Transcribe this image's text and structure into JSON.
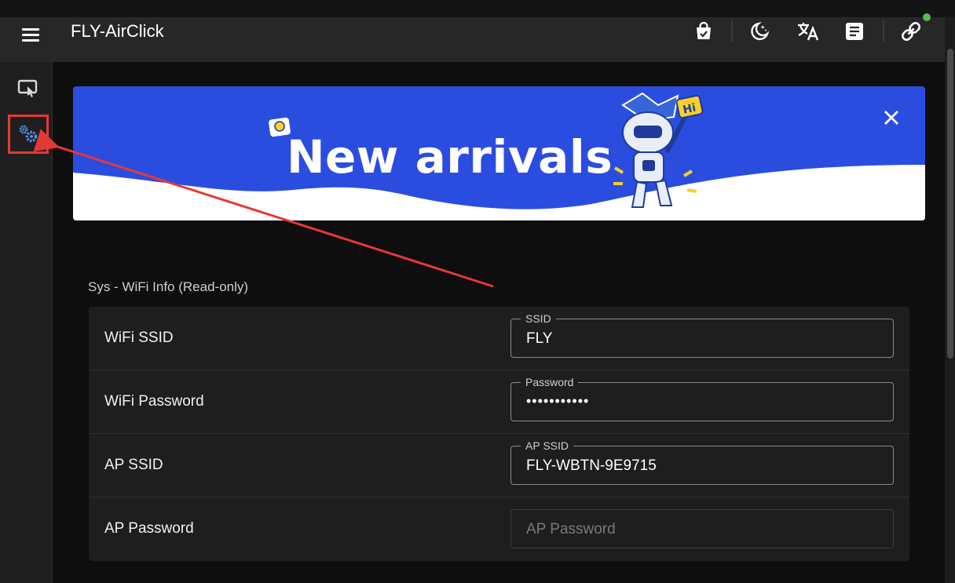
{
  "app": {
    "title": "FLY-AirClick"
  },
  "appbar": {
    "menu_icon": "menu-icon",
    "icons": [
      "shopping-bag-icon",
      "dark-mode-icon",
      "translate-icon",
      "notes-icon",
      "link-icon"
    ],
    "status_color": "#5cb85c"
  },
  "sidebar": {
    "items": [
      {
        "icon": "remote-control-icon",
        "active": false
      },
      {
        "icon": "settings-gears-icon",
        "active": true
      }
    ]
  },
  "banner": {
    "text": "New arrivals",
    "mascot_text": "Hi",
    "background": "#2a4de0"
  },
  "section": {
    "title": "Sys - WiFi Info (Read-only)",
    "rows": [
      {
        "label": "WiFi SSID",
        "field_label": "SSID",
        "value": "FLY"
      },
      {
        "label": "WiFi Password",
        "field_label": "Password",
        "value": "•••••••••••"
      },
      {
        "label": "AP SSID",
        "field_label": "AP SSID",
        "value": "FLY-WBTN-9E9715"
      },
      {
        "label": "AP Password",
        "placeholder": "AP Password",
        "value": ""
      }
    ]
  },
  "annotation": {
    "color": "#e53935"
  }
}
